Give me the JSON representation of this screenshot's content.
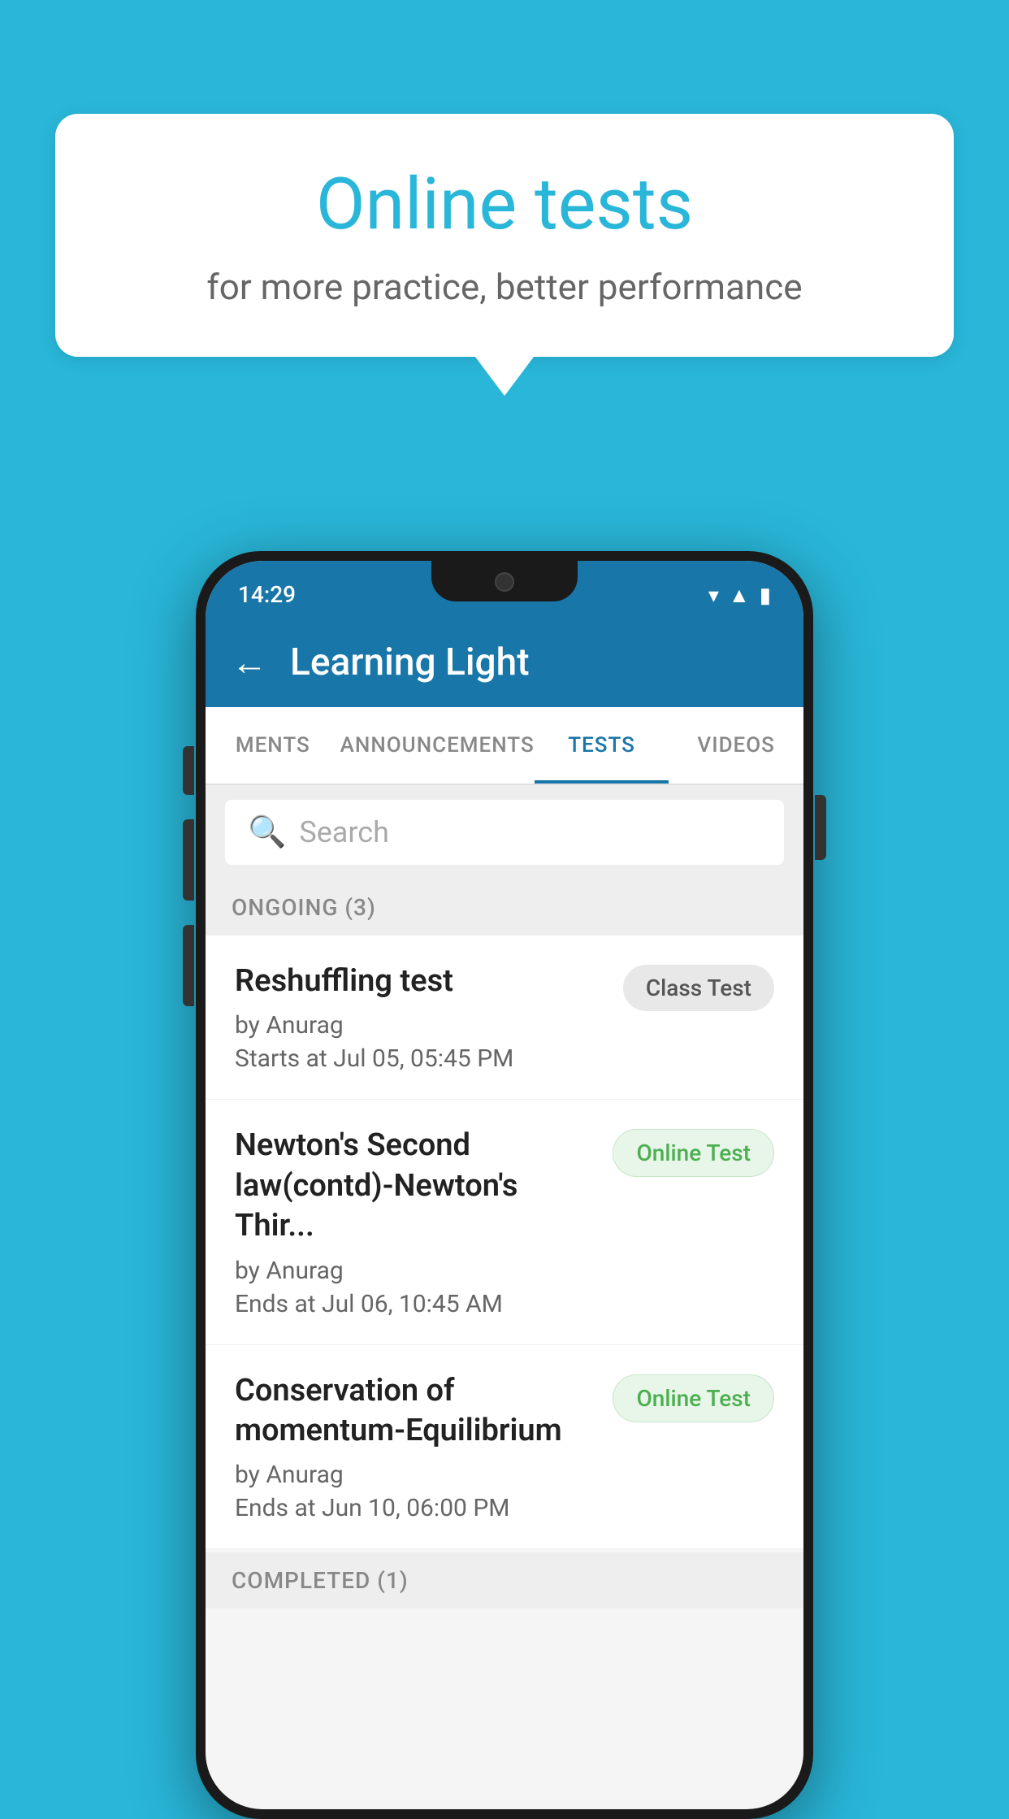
{
  "background_color": "#29b6d8",
  "speech_bubble": {
    "title": "Online tests",
    "subtitle": "for more practice, better performance"
  },
  "phone": {
    "status_bar": {
      "time": "14:29",
      "icons": [
        "wifi",
        "signal",
        "battery"
      ]
    },
    "app_bar": {
      "title": "Learning Light",
      "back_label": "←"
    },
    "tabs": [
      {
        "label": "MENTS",
        "active": false
      },
      {
        "label": "ANNOUNCEMENTS",
        "active": false
      },
      {
        "label": "TESTS",
        "active": true
      },
      {
        "label": "VIDEOS",
        "active": false
      }
    ],
    "search": {
      "placeholder": "Search"
    },
    "ongoing_section": {
      "header": "ONGOING (3)",
      "tests": [
        {
          "title": "Reshuffling test",
          "author": "by Anurag",
          "date": "Starts at  Jul 05, 05:45 PM",
          "badge": "Class Test",
          "badge_type": "class"
        },
        {
          "title": "Newton's Second law(contd)-Newton's Thir...",
          "author": "by Anurag",
          "date": "Ends at  Jul 06, 10:45 AM",
          "badge": "Online Test",
          "badge_type": "online"
        },
        {
          "title": "Conservation of momentum-Equilibrium",
          "author": "by Anurag",
          "date": "Ends at  Jun 10, 06:00 PM",
          "badge": "Online Test",
          "badge_type": "online"
        }
      ]
    },
    "completed_section": {
      "header": "COMPLETED (1)"
    }
  }
}
